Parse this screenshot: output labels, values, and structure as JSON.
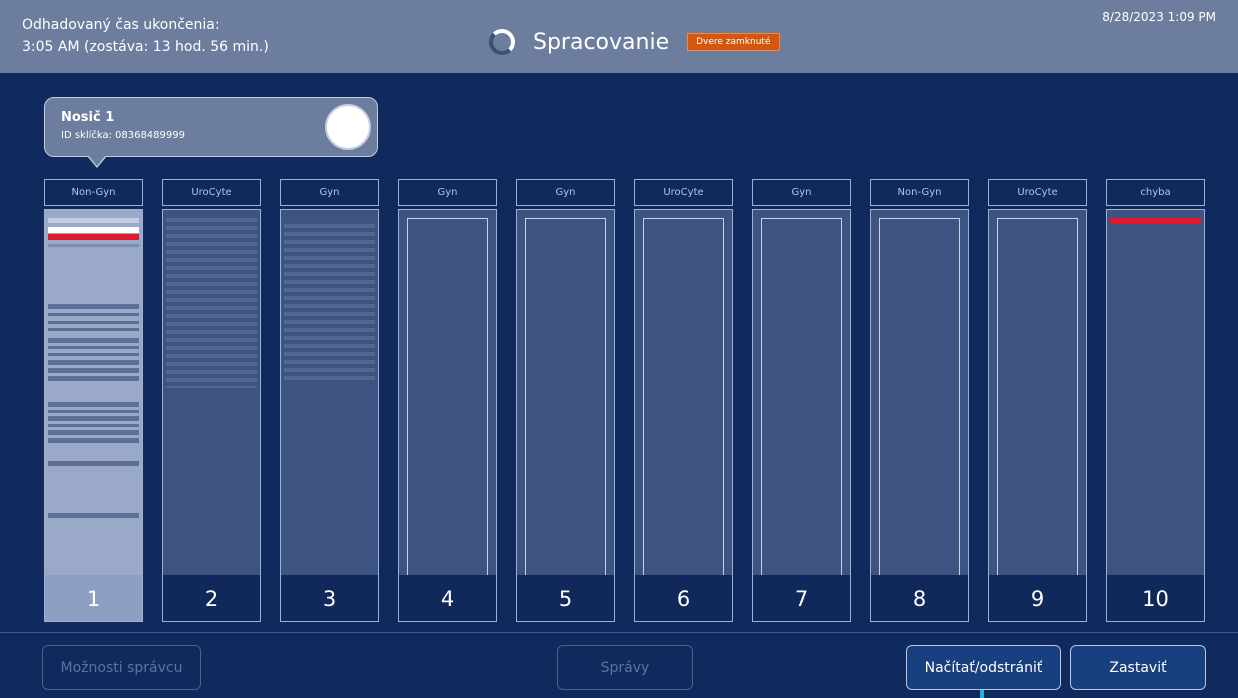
{
  "header": {
    "estimate_line1": "Odhadovaný čas ukončenia:",
    "estimate_line2": "3:05 AM (zostáva: 13 hod. 56 min.)",
    "title": "Spracovanie",
    "door_badge": "Dvere zamknuté",
    "datetime": "8/28/2023 1:09 PM",
    "badge_color": "#d4570d"
  },
  "tooltip": {
    "title": "Nosič 1",
    "id_label": "ID sklíčka:",
    "id_value": "08368489999"
  },
  "slots": [
    {
      "label": "Non-Gyn",
      "number": "1"
    },
    {
      "label": "UroCyte",
      "number": "2"
    },
    {
      "label": "Gyn",
      "number": "3"
    },
    {
      "label": "Gyn",
      "number": "4"
    },
    {
      "label": "Gyn",
      "number": "5"
    },
    {
      "label": "UroCyte",
      "number": "6"
    },
    {
      "label": "Gyn",
      "number": "7"
    },
    {
      "label": "Non-Gyn",
      "number": "8"
    },
    {
      "label": "UroCyte",
      "number": "9"
    },
    {
      "label": "chyba",
      "number": "10"
    }
  ],
  "footer": {
    "admin_options": "Možnosti správcu",
    "messages": "Správy",
    "load_remove": "Načítať/odstrániť",
    "stop": "Zastaviť"
  },
  "colors": {
    "background": "#102a5e",
    "header": "#6c7d9e",
    "error": "#e0192e"
  }
}
